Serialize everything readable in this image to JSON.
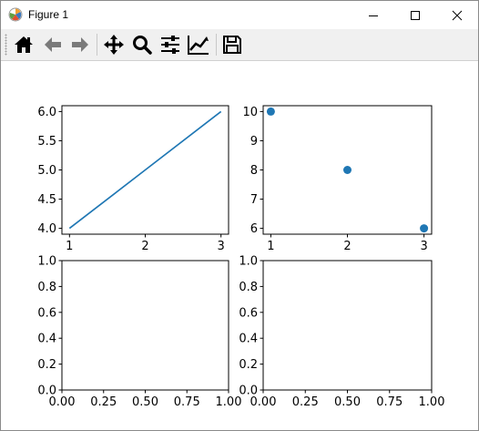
{
  "window": {
    "title": "Figure 1",
    "controls": {
      "minimize": "minimize",
      "maximize": "maximize",
      "close": "close"
    }
  },
  "toolbar": {
    "buttons": [
      {
        "name": "home",
        "icon": "home-icon"
      },
      {
        "name": "back",
        "icon": "arrow-left-icon"
      },
      {
        "name": "forward",
        "icon": "arrow-right-icon"
      },
      {
        "name": "pan",
        "icon": "move-icon"
      },
      {
        "name": "zoom",
        "icon": "magnifier-icon"
      },
      {
        "name": "configure-subplots",
        "icon": "sliders-icon"
      },
      {
        "name": "edit-axes",
        "icon": "line-chart-icon"
      },
      {
        "name": "save",
        "icon": "floppy-disk-icon"
      }
    ]
  },
  "colors": {
    "series": "#1f77b4",
    "axes": "#000000",
    "toolbar": "#f0f0f0"
  },
  "chart_data": [
    {
      "type": "line",
      "x": [
        1,
        2,
        3
      ],
      "y": [
        4,
        5,
        6
      ],
      "xlim": [
        0.9,
        3.1
      ],
      "ylim": [
        3.9,
        6.1
      ],
      "xticks": [
        1,
        2,
        3
      ],
      "xtick_labels": [
        "1",
        "2",
        "3"
      ],
      "yticks": [
        4.0,
        4.5,
        5.0,
        5.5,
        6.0
      ],
      "ytick_labels": [
        "4.0",
        "4.5",
        "5.0",
        "5.5",
        "6.0"
      ]
    },
    {
      "type": "scatter",
      "x": [
        1,
        2,
        3
      ],
      "y": [
        10,
        8,
        6
      ],
      "xlim": [
        0.9,
        3.1
      ],
      "ylim": [
        5.8,
        10.2
      ],
      "xticks": [
        1,
        2,
        3
      ],
      "xtick_labels": [
        "1",
        "2",
        "3"
      ],
      "yticks": [
        6,
        7,
        8,
        9,
        10
      ],
      "ytick_labels": [
        "6",
        "7",
        "8",
        "9",
        "10"
      ]
    },
    {
      "type": "line",
      "x": [],
      "y": [],
      "xlim": [
        0,
        1
      ],
      "ylim": [
        0,
        1
      ],
      "xticks": [
        0,
        0.25,
        0.5,
        0.75,
        1
      ],
      "xtick_labels": [
        "0.00",
        "0.25",
        "0.50",
        "0.75",
        "1.00"
      ],
      "yticks": [
        0,
        0.2,
        0.4,
        0.6,
        0.8,
        1
      ],
      "ytick_labels": [
        "0.0",
        "0.2",
        "0.4",
        "0.6",
        "0.8",
        "1.0"
      ]
    },
    {
      "type": "line",
      "x": [],
      "y": [],
      "xlim": [
        0,
        1
      ],
      "ylim": [
        0,
        1
      ],
      "xticks": [
        0,
        0.25,
        0.5,
        0.75,
        1
      ],
      "xtick_labels": [
        "0.00",
        "0.25",
        "0.50",
        "0.75",
        "1.00"
      ],
      "yticks": [
        0,
        0.2,
        0.4,
        0.6,
        0.8,
        1
      ],
      "ytick_labels": [
        "0.0",
        "0.2",
        "0.4",
        "0.6",
        "0.8",
        "1.0"
      ]
    }
  ]
}
